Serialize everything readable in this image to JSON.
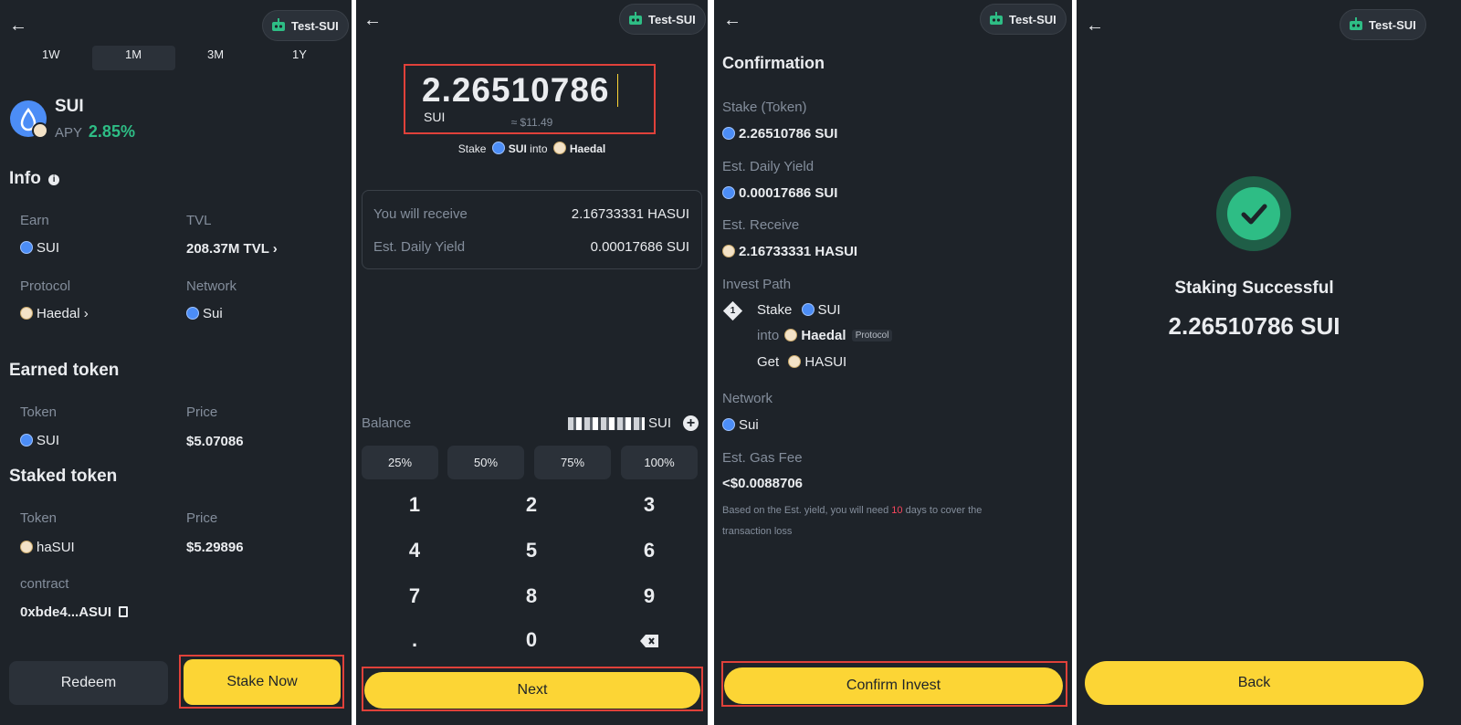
{
  "common": {
    "badge_label": "Test-SUI"
  },
  "panel1": {
    "tabs": [
      "1W",
      "1M",
      "3M",
      "1Y"
    ],
    "token_name": "SUI",
    "apy_label": "APY",
    "apy_value": "2.85%",
    "info_title": "Info",
    "earn_label": "Earn",
    "earn_value": "SUI",
    "tvl_label": "TVL",
    "tvl_value": "208.37M TVL",
    "protocol_label": "Protocol",
    "protocol_value": "Haedal",
    "network_label": "Network",
    "network_value": "Sui",
    "earned_title": "Earned token",
    "earned_token_label": "Token",
    "earned_token_value": "SUI",
    "earned_price_label": "Price",
    "earned_price_value": "$5.07086",
    "staked_title": "Staked token",
    "staked_token_label": "Token",
    "staked_token_value": "haSUI",
    "staked_price_label": "Price",
    "staked_price_value": "$5.29896",
    "contract_label": "contract",
    "contract_value": "0xbde4...ASUI",
    "redeem_label": "Redeem",
    "stake_now_label": "Stake Now"
  },
  "panel2": {
    "amount": "2.26510786",
    "unit": "SUI",
    "usd_value": "≈ $11.49",
    "stake_word": "Stake",
    "stake_token": "SUI",
    "into_word": "into",
    "protocol": "Haedal",
    "receive_label": "You will receive",
    "receive_value": "2.16733331 HASUI",
    "yield_label": "Est. Daily Yield",
    "yield_value": "0.00017686 SUI",
    "balance_label": "Balance",
    "balance_unit": "SUI",
    "percents": [
      "25%",
      "50%",
      "75%",
      "100%"
    ],
    "keys": [
      "1",
      "2",
      "3",
      "4",
      "5",
      "6",
      "7",
      "8",
      "9",
      ".",
      "0"
    ],
    "next_label": "Next"
  },
  "panel3": {
    "title": "Confirmation",
    "stake_label": "Stake (Token)",
    "stake_value": "2.26510786 SUI",
    "yield_label": "Est. Daily Yield",
    "yield_value": "0.00017686 SUI",
    "receive_label": "Est. Receive",
    "receive_value": "2.16733331 HASUI",
    "path_label": "Invest Path",
    "step_number": "1",
    "path_stake": "Stake",
    "path_stake_token": "SUI",
    "path_into": "into",
    "path_protocol": "Haedal",
    "path_protocol_tag": "Protocol",
    "path_get": "Get",
    "path_get_token": "HASUI",
    "network_label": "Network",
    "network_value": "Sui",
    "gas_label": "Est. Gas Fee",
    "gas_value": "<$0.0088706",
    "note_prefix": "Based on the Est. yield, you will need",
    "note_days": "10",
    "note_suffix": "days to cover the",
    "note_line2": "transaction loss",
    "confirm_label": "Confirm Invest"
  },
  "panel4": {
    "success_title": "Staking Successful",
    "success_amount": "2.26510786 SUI",
    "back_label": "Back"
  },
  "colors": {
    "bg": "#1e2329",
    "card": "#2b3139",
    "accent": "#fcd535",
    "positive": "#2ebd85",
    "highlight": "#e0413a",
    "sui": "#4c8df6"
  }
}
